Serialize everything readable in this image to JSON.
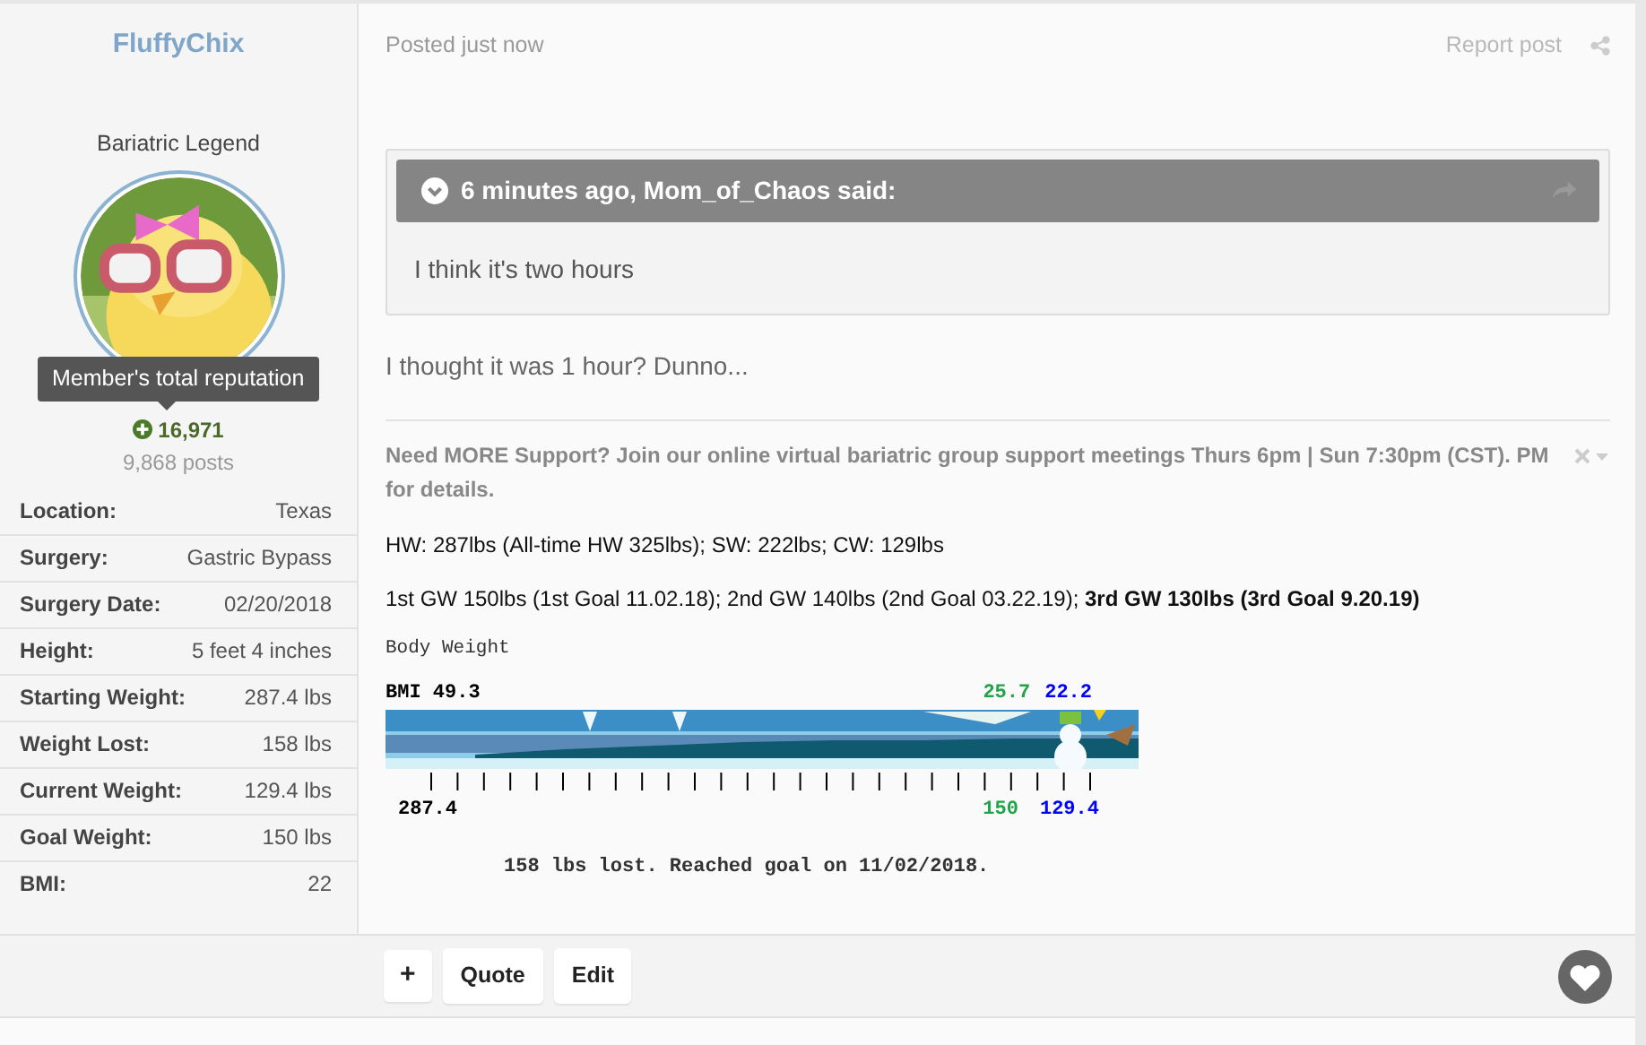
{
  "author": {
    "name": "FluffyChix",
    "title": "Bariatric Legend",
    "tooltip": "Member's total reputation",
    "reputation": "16,971",
    "posts": "9,868 posts"
  },
  "profile_fields": [
    {
      "label": "Location:",
      "value": "Texas"
    },
    {
      "label": "Surgery:",
      "value": "Gastric Bypass"
    },
    {
      "label": "Surgery Date:",
      "value": "02/20/2018"
    },
    {
      "label": "Height:",
      "value": "5 feet 4 inches"
    },
    {
      "label": "Starting Weight:",
      "value": "287.4 lbs"
    },
    {
      "label": "Weight Lost:",
      "value": "158 lbs"
    },
    {
      "label": "Current Weight:",
      "value": "129.4 lbs"
    },
    {
      "label": "Goal Weight:",
      "value": "150 lbs"
    },
    {
      "label": "BMI:",
      "value": "22"
    }
  ],
  "post": {
    "timestamp": "Posted just now",
    "report_link": "Report post",
    "quote": {
      "header": "6 minutes ago, Mom_of_Chaos said:",
      "text": "I think it's two hours"
    },
    "body": "I thought it was 1 hour? Dunno..."
  },
  "signature": {
    "announcement": "Need MORE Support? Join our online virtual bariatric group support meetings Thurs 6pm | Sun 7:30pm (CST). PM for details.",
    "lines": [
      "HW: 287lbs (All-time HW 325lbs); SW: 222lbs; CW: 129lbs",
      "1st GW 150lbs (1st Goal 11.02.18); 2nd GW 140lbs (2nd Goal 03.22.19); **3rd GW 130lbs (3rd Goal 9.20.19)**"
    ],
    "ticker": {
      "title": "Body Weight",
      "top_labels": [
        {
          "text": "BMI 49.3",
          "color": "#000000"
        },
        {
          "text": "25.7",
          "color": "#22a34a"
        },
        {
          "text": "22.2",
          "color": "#0000ff"
        }
      ],
      "bottom_labels": [
        {
          "text": "287.4",
          "color": "#000000"
        },
        {
          "text": "150",
          "color": "#22a34a"
        },
        {
          "text": "129.4",
          "color": "#0000ff"
        }
      ],
      "caption": "158 lbs lost. Reached goal on 11/02/2018."
    }
  },
  "actions": [
    "+",
    "Quote",
    "Edit"
  ]
}
